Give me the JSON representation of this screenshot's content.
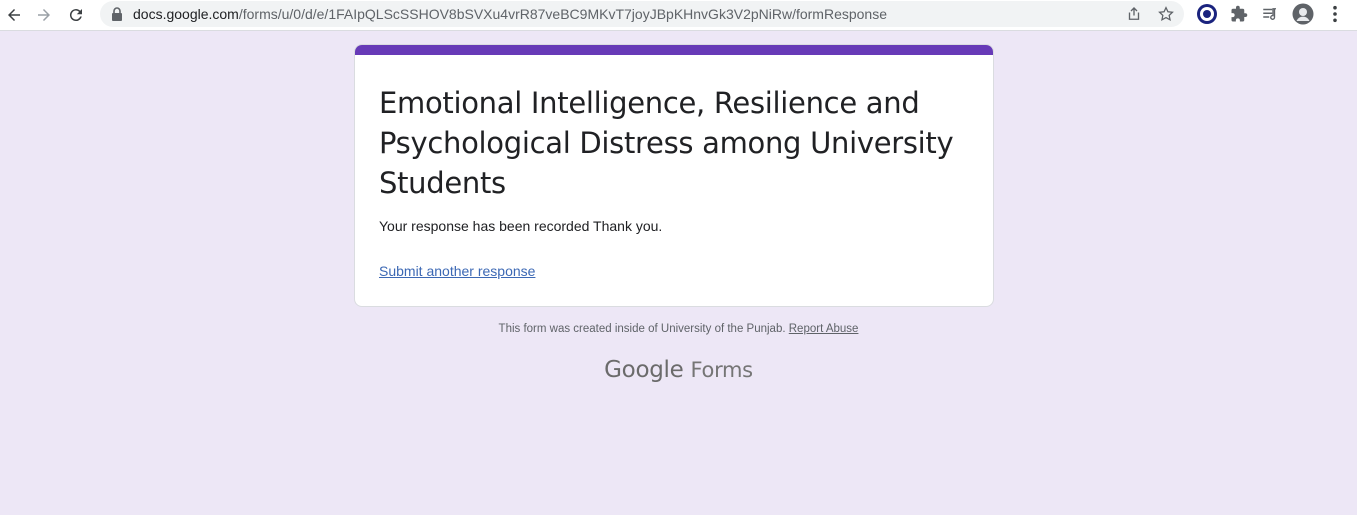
{
  "browser": {
    "url_host": "docs.google.com",
    "url_path": "/forms/u/0/d/e/1FAIpQLScSSHOV8bSVXu4vrR87veBC9MKvT7joyJBpKHnvGk3V2pNiRw/formResponse"
  },
  "form": {
    "title": "Emotional Intelligence, Resilience and Psychological Distress among University Students",
    "confirmation": "Your response has been recorded Thank you.",
    "submit_another": "Submit another response",
    "accent_color": "#673ab7"
  },
  "footer": {
    "created_text": "This form was created inside of University of the Punjab.",
    "report_abuse": "Report Abuse",
    "logo_google": "Google",
    "logo_forms": "Forms"
  },
  "colors": {
    "page_background": "#ede7f6"
  }
}
